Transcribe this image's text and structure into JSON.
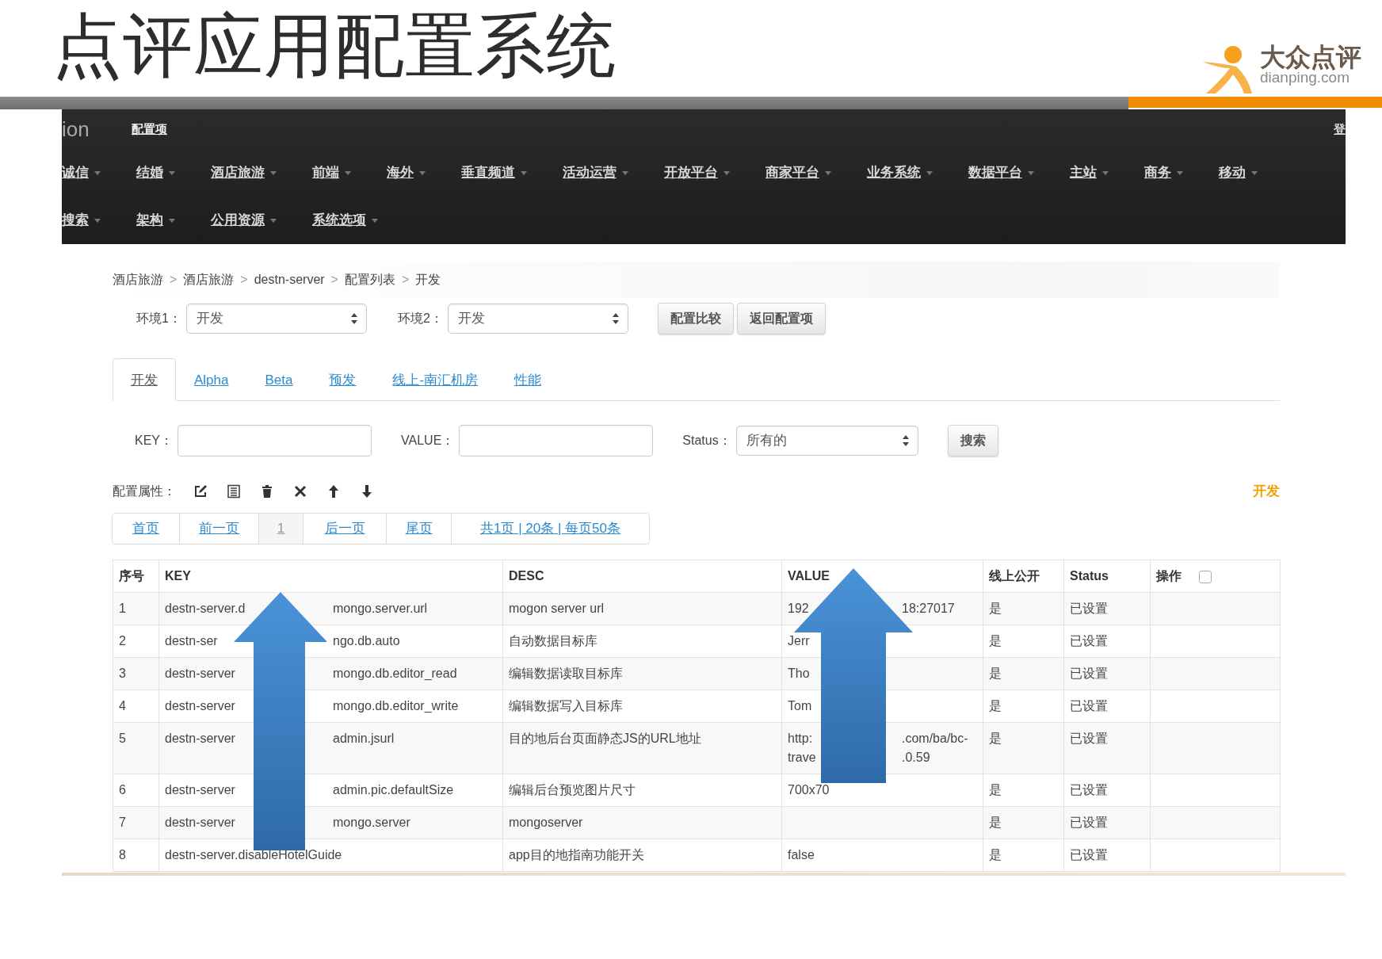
{
  "slide": {
    "title": "点评应用配置系统",
    "logo": {
      "name": "大众点评",
      "domain": "dianping.com"
    }
  },
  "navbar": {
    "brand": "ion",
    "title": "配置项",
    "login": "登",
    "menu_rows": [
      [
        {
          "label": "诚信"
        },
        {
          "label": "结婚"
        },
        {
          "label": "酒店旅游"
        },
        {
          "label": "前端"
        },
        {
          "label": "海外"
        },
        {
          "label": "垂直频道"
        },
        {
          "label": "活动运营"
        },
        {
          "label": "开放平台"
        },
        {
          "label": "商家平台"
        },
        {
          "label": "业务系统"
        },
        {
          "label": "数据平台"
        },
        {
          "label": "主站"
        },
        {
          "label": "商务"
        },
        {
          "label": "移动"
        }
      ],
      [
        {
          "label": "搜索"
        },
        {
          "label": "架构"
        },
        {
          "label": "公用资源"
        },
        {
          "label": "系统选项"
        }
      ]
    ]
  },
  "breadcrumb": [
    {
      "label": "酒店旅游",
      "separator": ">"
    },
    {
      "label": "酒店旅游",
      "separator": ">"
    },
    {
      "label": "destn-server",
      "separator": ">"
    },
    {
      "label": "配置列表",
      "separator": ">"
    },
    {
      "label": "开发"
    }
  ],
  "env": {
    "fields": [
      {
        "label": "环境1：",
        "value": "开发"
      },
      {
        "label": "环境2：",
        "value": "开发"
      }
    ],
    "buttons": [
      "配置比较",
      "返回配置项"
    ]
  },
  "tabs": [
    {
      "label": "开发",
      "selected": true
    },
    {
      "label": "Alpha",
      "selected": false
    },
    {
      "label": "Beta",
      "selected": false
    },
    {
      "label": "预发",
      "selected": false
    },
    {
      "label": "线上-南汇机房",
      "selected": false
    },
    {
      "label": "性能",
      "selected": false
    }
  ],
  "search": {
    "fields": [
      {
        "label": "KEY：",
        "kind": "input"
      },
      {
        "label": "VALUE：",
        "kind": "input"
      },
      {
        "label": "Status：",
        "kind": "select",
        "value": "所有的"
      }
    ],
    "button": "搜索"
  },
  "toolbar": {
    "label": "配置属性：",
    "env": "开发"
  },
  "pagination": [
    {
      "label": "首页",
      "selected": false
    },
    {
      "label": "前一页",
      "selected": false
    },
    {
      "label": "1",
      "selected": true
    },
    {
      "label": "后一页",
      "selected": false
    },
    {
      "label": "尾页",
      "selected": false
    },
    {
      "label": "共1页 | 20条 | 每页50条",
      "selected": false
    }
  ],
  "table": {
    "columns": [
      "序号",
      "KEY",
      "DESC",
      "VALUE",
      "线上公开",
      "Status",
      "操作"
    ],
    "select_all": {
      "checked": false
    },
    "rows": [
      {
        "no": "1",
        "key": [
          "destn-server.d",
          "mongo.server.url"
        ],
        "desc": "mogon server url",
        "value": [
          [
            "192",
            "18:27017"
          ]
        ],
        "public": "是",
        "status": "已设置"
      },
      {
        "no": "2",
        "key": [
          "destn-ser",
          "ngo.db.auto"
        ],
        "desc": "自动数据目标库",
        "value": [
          [
            "Jerr"
          ]
        ],
        "public": "是",
        "status": "已设置"
      },
      {
        "no": "3",
        "key": [
          "destn-server",
          "mongo.db.editor_read"
        ],
        "desc": "编辑数据读取目标库",
        "value": [
          [
            "Tho"
          ]
        ],
        "public": "是",
        "status": "已设置"
      },
      {
        "no": "4",
        "key": [
          "destn-server",
          "mongo.db.editor_write"
        ],
        "desc": "编辑数据写入目标库",
        "value": [
          [
            "Tom"
          ]
        ],
        "public": "是",
        "status": "已设置"
      },
      {
        "no": "5",
        "key": [
          "destn-server",
          "admin.jsurl"
        ],
        "desc": "目的地后台页面静态JS的URL地址",
        "value": [
          [
            "http:",
            ".com/ba/bc-"
          ],
          [
            "trave",
            ".0.59"
          ]
        ],
        "public": "是",
        "status": "已设置"
      },
      {
        "no": "6",
        "key": [
          "destn-server",
          "admin.pic.defaultSize"
        ],
        "desc": "编辑后台预览图片尺寸",
        "value": [
          [
            "700x70"
          ]
        ],
        "public": "是",
        "status": "已设置"
      },
      {
        "no": "7",
        "key": [
          "destn-server",
          "mongo.server"
        ],
        "desc": "mongoserver",
        "public": "是",
        "status": "已设置"
      },
      {
        "no": "8",
        "key": [
          "destn-server.disableHotelGuide"
        ],
        "desc": "app目的地指南功能开关",
        "value": [
          [
            "false"
          ]
        ],
        "public": "是",
        "status": "已设置"
      }
    ]
  }
}
